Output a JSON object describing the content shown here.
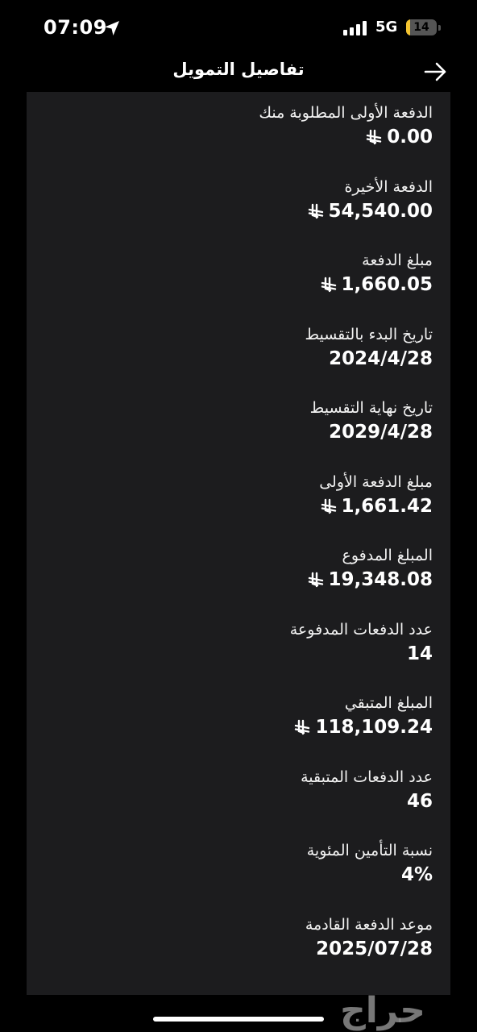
{
  "status_bar": {
    "time": "07:09",
    "network": "5G",
    "battery_level": "14",
    "battery_fraction": 0.14,
    "battery_color": "#f4c430",
    "icons": [
      "location-arrow-icon",
      "signal-bars-icon",
      "battery-icon"
    ]
  },
  "header": {
    "title": "تفاصيل التمويل",
    "back_icon": "arrow-right-icon"
  },
  "details": [
    {
      "label": "الدفعة الأولى المطلوبة منك",
      "value": "0.00",
      "currency": true
    },
    {
      "label": "الدفعة الأخيرة",
      "value": "54,540.00",
      "currency": true
    },
    {
      "label": "مبلغ الدفعة",
      "value": "1,660.05",
      "currency": true
    },
    {
      "label": "تاريخ البدء بالتقسيط",
      "value": "2024/4/28",
      "currency": false
    },
    {
      "label": "تاريخ نهاية التقسيط",
      "value": "2029/4/28",
      "currency": false
    },
    {
      "label": "مبلغ الدفعة الأولى",
      "value": "1,661.42",
      "currency": true
    },
    {
      "label": "المبلغ المدفوع",
      "value": "19,348.08",
      "currency": true
    },
    {
      "label": "عدد الدفعات المدفوعة",
      "value": "14",
      "currency": false
    },
    {
      "label": "المبلغ المتبقي",
      "value": "118,109.24",
      "currency": true
    },
    {
      "label": "عدد الدفعات المتبقية",
      "value": "46",
      "currency": false
    },
    {
      "label": "نسبة التأمين المئوية",
      "value": "4%",
      "currency": false
    },
    {
      "label": "موعد الدفعة القادمة",
      "value": "2025/07/28",
      "currency": false
    }
  ],
  "watermark": {
    "text": "حراج"
  }
}
